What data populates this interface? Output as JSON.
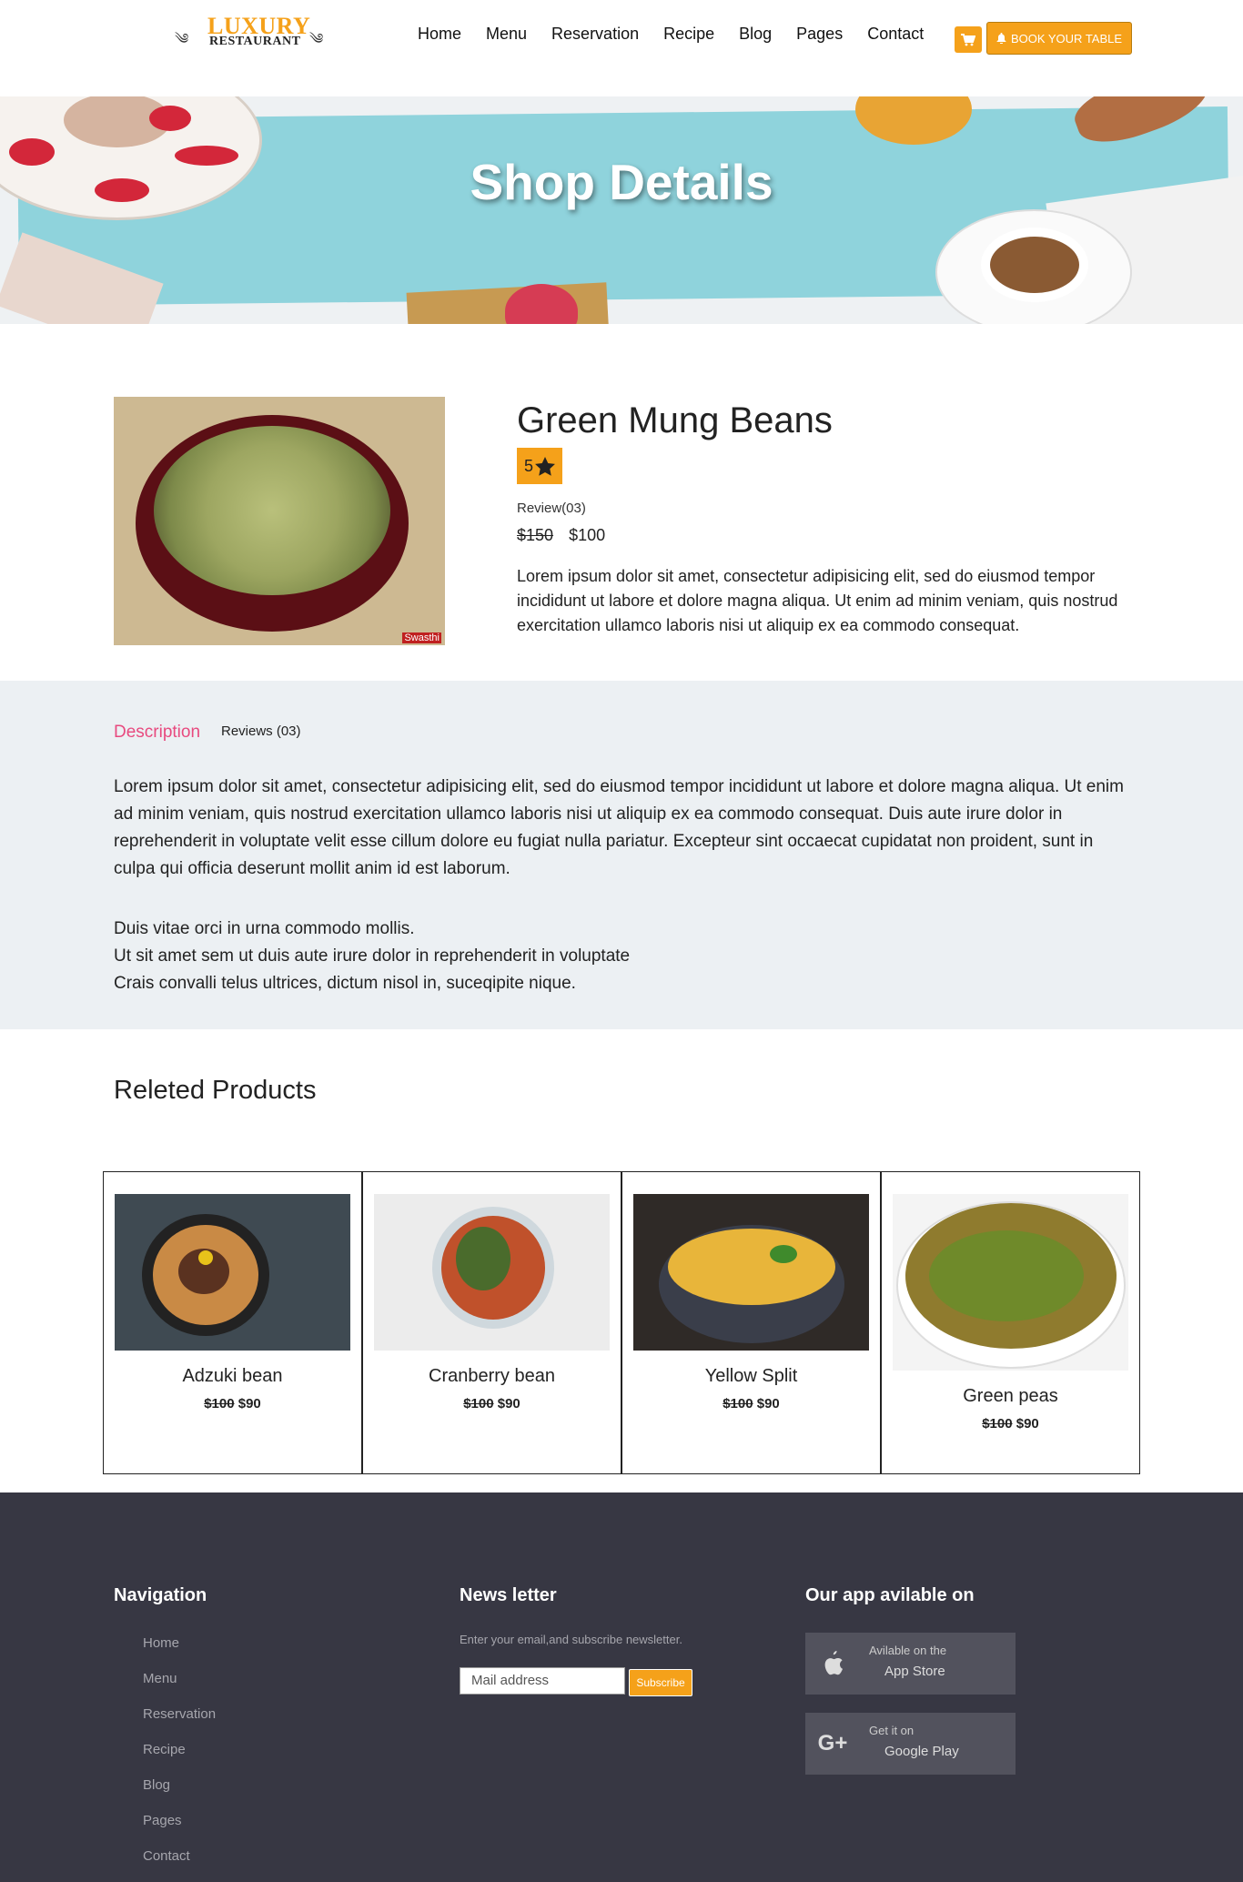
{
  "header": {
    "logo_line1": "LUXURY",
    "logo_line2": "RESTAURANT",
    "nav": [
      "Home",
      "Menu",
      "Reservation",
      "Recipe",
      "Blog",
      "Pages",
      "Contact"
    ],
    "book_label": "BOOK YOUR TABLE"
  },
  "hero": {
    "title": "Shop Details"
  },
  "product": {
    "title": "Green Mung Beans",
    "rating": "5",
    "review_count": "Review(03)",
    "old_price": "$150",
    "new_price": "$100",
    "description": "Lorem ipsum dolor sit amet, consectetur adipisicing elit, sed do eiusmod tempor incididunt ut labore et dolore magna aliqua. Ut enim ad minim veniam, quis nostrud exercitation ullamco laboris nisi ut aliquip ex ea commodo consequat.",
    "image_watermark": "Swasthi"
  },
  "tabs": {
    "description_label": "Description",
    "reviews_label": "Reviews (03)",
    "long_description": "Lorem ipsum dolor sit amet, consectetur adipisicing elit, sed do eiusmod tempor incididunt ut labore et dolore magna aliqua. Ut enim ad minim veniam, quis nostrud exercitation ullamco laboris nisi ut aliquip ex ea commodo consequat. Duis aute irure dolor in reprehenderit in voluptate velit esse cillum dolore eu fugiat nulla pariatur. Excepteur sint occaecat cupidatat non proident, sunt in culpa qui officia deserunt mollit anim id est laborum.",
    "lines": [
      "Duis vitae orci in urna commodo mollis.",
      "Ut sit amet sem ut duis aute irure dolor in reprehenderit in voluptate",
      "Crais convalli telus ultrices, dictum nisol in, suceqipite nique."
    ]
  },
  "related": {
    "title": "Releted Products",
    "items": [
      {
        "name": "Adzuki bean",
        "old_price": "$100",
        "new_price": "$90"
      },
      {
        "name": "Cranberry bean",
        "old_price": "$100",
        "new_price": "$90"
      },
      {
        "name": "Yellow Split",
        "old_price": "$100",
        "new_price": "$90"
      },
      {
        "name": "Green peas",
        "old_price": "$100",
        "new_price": "$90"
      }
    ]
  },
  "footer": {
    "nav_title": "Navigation",
    "nav_items": [
      "Home",
      "Menu",
      "Reservation",
      "Recipe",
      "Blog",
      "Pages",
      "Contact"
    ],
    "newsletter_title": "News letter",
    "newsletter_text": "Enter your email,and subscribe newsletter.",
    "email_placeholder": "Mail address",
    "subscribe_label": "Subscribe",
    "app_title": "Our app avilable on",
    "app_store_line1": "Avilable on the",
    "app_store_line2": "App Store",
    "google_line1": "Get it on",
    "google_line2": "Google Play"
  },
  "colors": {
    "accent": "#f5a11a",
    "tab_active": "#e84a7f",
    "footer_bg": "#373743",
    "tabs_bg": "#ecf0f3"
  },
  "icons": {
    "cart": "cart-icon",
    "bell": "bell-icon",
    "star": "star-icon",
    "apple": "apple-icon",
    "google_plus": "google-plus-icon"
  }
}
